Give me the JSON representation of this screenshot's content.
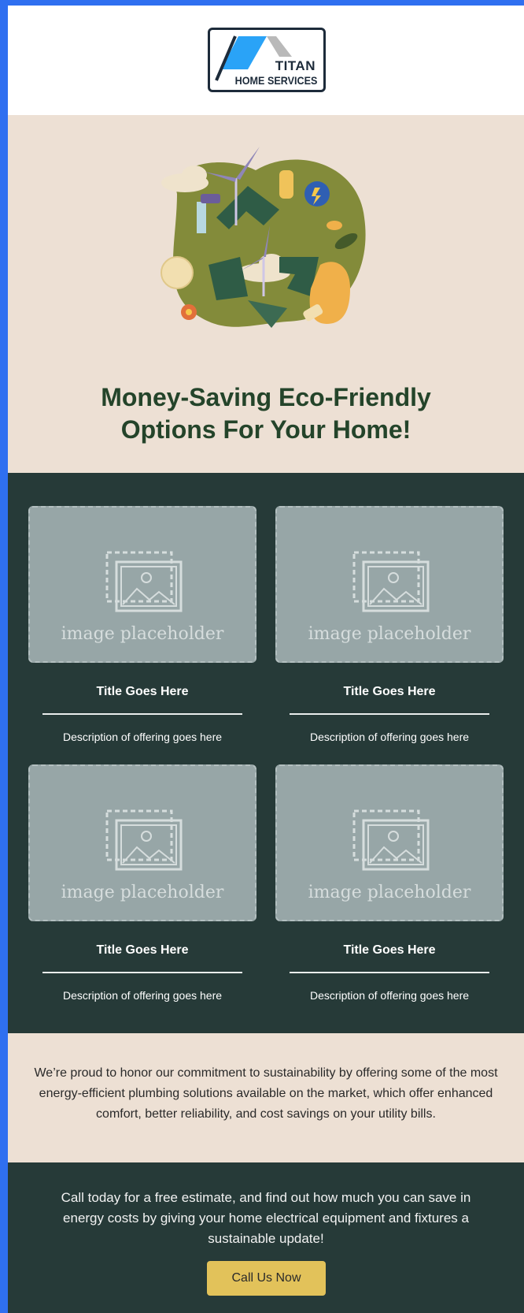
{
  "logo": {
    "line1": "TITAN",
    "line2": "HOME SERVICES",
    "colors": {
      "roof": "#2aa3f7",
      "roof_gray": "#b9b9b9",
      "outline": "#1d2b3a"
    }
  },
  "hero": {
    "title": "Money-Saving Eco-Friendly Options For Your Home!"
  },
  "offerings": {
    "cards": [
      {
        "image_label": "image placeholder",
        "title": "Title Goes Here",
        "description": "Description of offering goes here"
      },
      {
        "image_label": "image placeholder",
        "title": "Title Goes Here",
        "description": "Description of offering goes here"
      },
      {
        "image_label": "image placeholder",
        "title": "Title Goes Here",
        "description": "Description of offering goes here"
      },
      {
        "image_label": "image placeholder",
        "title": "Title Goes Here",
        "description": "Description of offering goes here"
      }
    ]
  },
  "commitment": {
    "text": "We’re proud to honor our commitment to sustainability by offering some of the most energy-efficient plumbing solutions available on the market, which offer enhanced comfort, better reliability, and cost savings on your utility bills."
  },
  "cta": {
    "text": "Call today for a free estimate, and find out how much you can save in energy costs by giving your home electrical equipment and fixtures a sustainable update!",
    "button_label": "Call Us Now"
  },
  "colors": {
    "frame": "#2f6ff0",
    "beige": "#ede0d4",
    "dark_green": "#263a38",
    "title_green": "#24442a",
    "button_gold": "#e2c25a"
  }
}
